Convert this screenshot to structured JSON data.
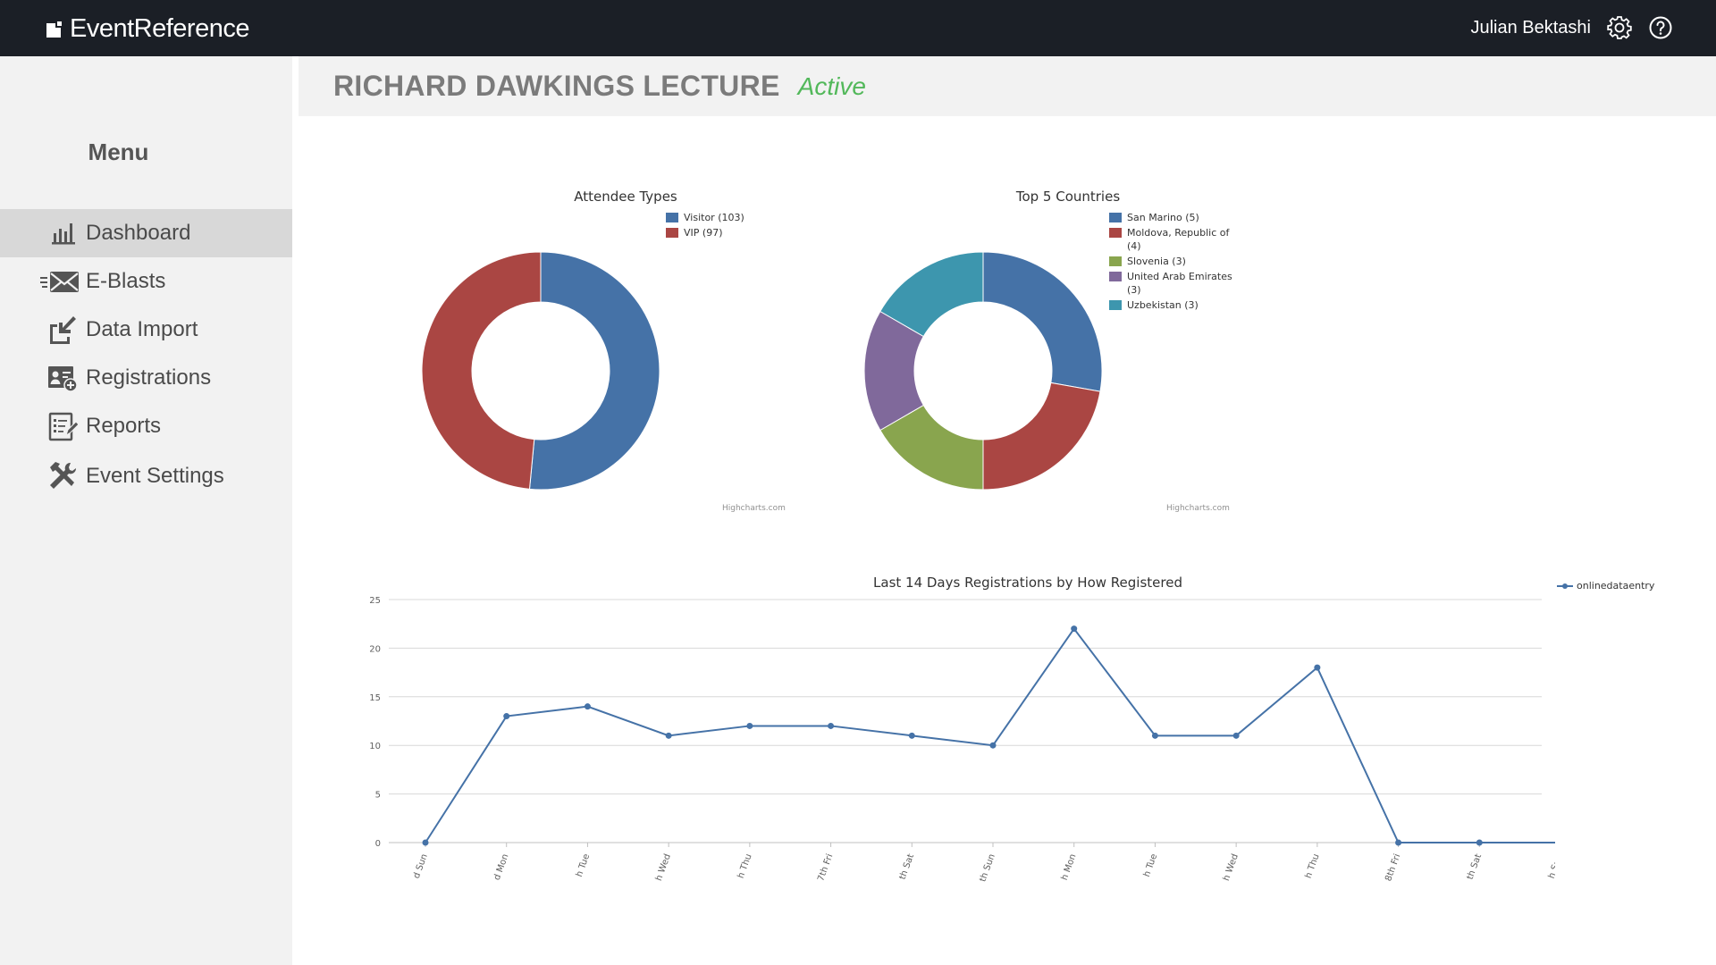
{
  "app": {
    "brand": "EventReference"
  },
  "header": {
    "user_name": "Julian Bektashi",
    "settings_icon": "gear-icon",
    "help_icon": "help-circle-icon"
  },
  "sidebar": {
    "menu_title": "Menu",
    "items": [
      {
        "label": "Dashboard",
        "icon": "bar-chart-icon",
        "active": true
      },
      {
        "label": "E-Blasts",
        "icon": "envelope-send-icon",
        "active": false
      },
      {
        "label": "Data Import",
        "icon": "import-icon",
        "active": false
      },
      {
        "label": "Registrations",
        "icon": "registration-card-icon",
        "active": false
      },
      {
        "label": "Reports",
        "icon": "report-icon",
        "active": false
      },
      {
        "label": "Event Settings",
        "icon": "tools-icon",
        "active": false
      }
    ]
  },
  "event": {
    "title": "RICHARD DAWKINGS LECTURE",
    "status": "Active",
    "status_color": "#52b85a"
  },
  "charts": {
    "credits": "Highcharts.com"
  },
  "chart_data": [
    {
      "type": "pie",
      "title": "Attendee Types",
      "slices": [
        {
          "name": "Visitor (103)",
          "value": 103,
          "color": "#4572a7"
        },
        {
          "name": "VIP (97)",
          "value": 97,
          "color": "#aa4643"
        }
      ]
    },
    {
      "type": "pie",
      "title": "Top 5 Countries",
      "slices": [
        {
          "name": "San Marino (5)",
          "value": 5,
          "color": "#4572a7"
        },
        {
          "name": "Moldova, Republic of (4)",
          "value": 4,
          "color": "#aa4643"
        },
        {
          "name": "Slovenia (3)",
          "value": 3,
          "color": "#89a54e"
        },
        {
          "name": "United Arab Emirates (3)",
          "value": 3,
          "color": "#80699b"
        },
        {
          "name": "Uzbekistan (3)",
          "value": 3,
          "color": "#3d96ae"
        }
      ]
    },
    {
      "type": "line",
      "title": "Last 14 Days Registrations by How Registered",
      "categories": [
        "d Sun",
        "d Mon",
        "h Tue",
        "h Wed",
        "h Thu",
        "7th Fri",
        "th Sat",
        "th Sun",
        "h Mon",
        "h Tue",
        "h Wed",
        "h Thu",
        "8th Fri",
        "th Sat",
        "h Sun"
      ],
      "series": [
        {
          "name": "onlinedataentry",
          "color": "#4572a7",
          "values": [
            0,
            13,
            14,
            11,
            12,
            12,
            11,
            10,
            22,
            11,
            11,
            18,
            0,
            0,
            0
          ]
        }
      ],
      "ylim": [
        0,
        25
      ],
      "yticks": [
        0,
        5,
        10,
        15,
        20,
        25
      ],
      "grid": true,
      "legend_position": "top-right"
    }
  ]
}
